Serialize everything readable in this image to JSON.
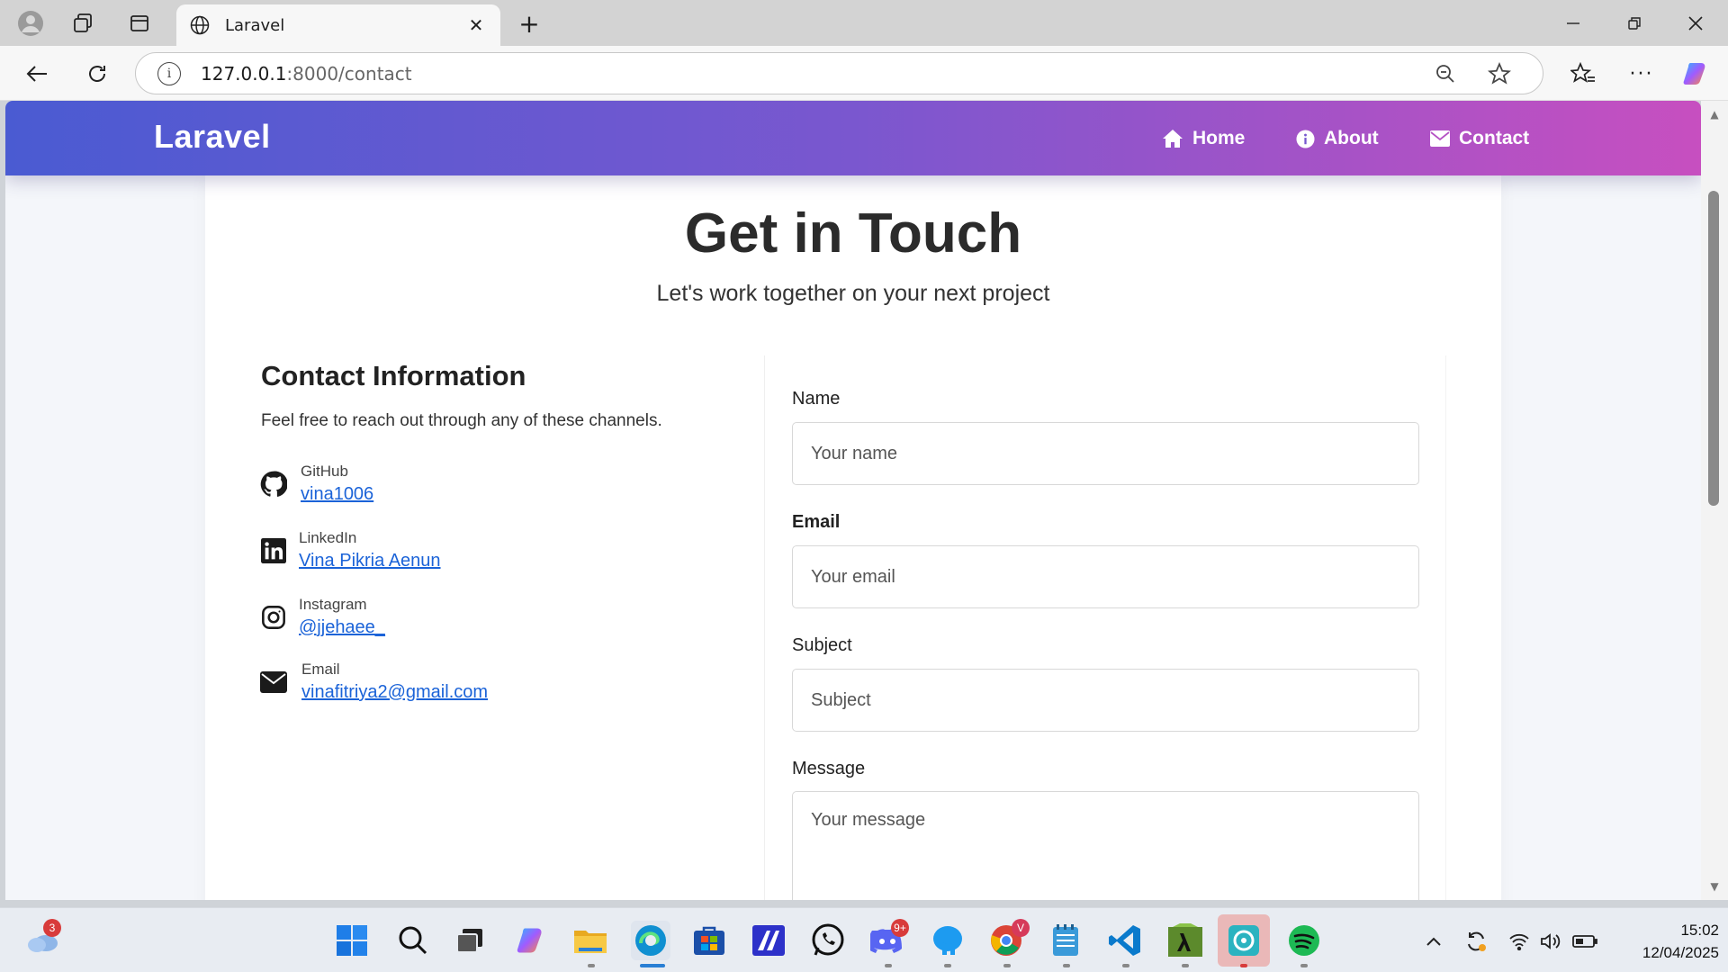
{
  "browser": {
    "tab_title": "Laravel",
    "url_host": "127.0.0.1",
    "url_rest": ":8000/contact"
  },
  "nav": {
    "brand": "Laravel",
    "links": [
      {
        "label": "Home",
        "icon": "home-icon"
      },
      {
        "label": "About",
        "icon": "info-icon"
      },
      {
        "label": "Contact",
        "icon": "envelope-icon"
      }
    ],
    "gradient": [
      "#4a5bd2",
      "#7a57cf",
      "#c74fc0"
    ]
  },
  "hero": {
    "title": "Get in Touch",
    "subtitle": "Let's work together on your next project"
  },
  "contact_info": {
    "title": "Contact Information",
    "description": "Feel free to reach out through any of these channels.",
    "items": [
      {
        "label": "GitHub",
        "value": "vina1006",
        "icon": "github-icon"
      },
      {
        "label": "LinkedIn",
        "value": "Vina Pikria Aenun",
        "icon": "linkedin-icon"
      },
      {
        "label": "Instagram",
        "value": "@jjehaee_",
        "icon": "instagram-icon"
      },
      {
        "label": "Email",
        "value": "vinafitriya2@gmail.com",
        "icon": "envelope-icon"
      }
    ],
    "link_color": "#1b63d8"
  },
  "form": {
    "name_label": "Name",
    "name_placeholder": "Your name",
    "email_label": "Email",
    "email_placeholder": "Your email",
    "subject_label": "Subject",
    "subject_placeholder": "Subject",
    "message_label": "Message",
    "message_placeholder": "Your message"
  },
  "taskbar": {
    "weather_badge": "3",
    "discord_badge": "9+",
    "chrome_badge": "V",
    "time": "15:02",
    "date": "12/04/2025"
  }
}
